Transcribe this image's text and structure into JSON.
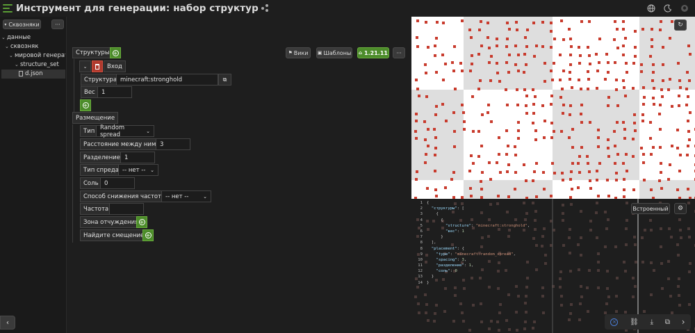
{
  "header": {
    "title": "Инструмент для генерации: набор структур",
    "icons": [
      "globe-icon",
      "moon-icon",
      "github-icon"
    ]
  },
  "sidebar": {
    "project_button": "Сквозняки",
    "more_label": "···",
    "tree": [
      {
        "label": "данные",
        "level": 0,
        "expanded": true
      },
      {
        "label": "сквозняк",
        "level": 1,
        "expanded": true
      },
      {
        "label": "мировой генератор",
        "level": 2,
        "expanded": true
      },
      {
        "label": "structure_set",
        "level": 3,
        "expanded": true
      },
      {
        "label": "d.json",
        "level": 4,
        "file": true,
        "selected": true
      }
    ]
  },
  "toolbar": {
    "wiki_label": "Вики",
    "templates_label": "Шаблоны",
    "version_label": "1.21.11",
    "more_label": "···"
  },
  "editor": {
    "structures_label": "Структуры",
    "entry_label": "Вход",
    "structure_field_label": "Структура",
    "structure_value": "minecraft:stronghold",
    "weight_label": "Вес",
    "weight_value": "1",
    "placement_label": "Размещение",
    "type_label": "Тип",
    "type_value": "Random spread",
    "spacing_label": "Расстояние между ними",
    "spacing_value": "3",
    "separation_label": "Разделение",
    "separation_value": "1",
    "spread_type_label": "Тип спреда",
    "spread_type_value": "-- нет --",
    "salt_label": "Соль",
    "salt_value": "0",
    "freq_method_label": "Способ снижения частоты",
    "freq_method_value": "-- нет --",
    "frequency_label": "Частота",
    "frequency_value": "",
    "exclusion_label": "Зона отчуждения",
    "offset_label": "Найдите смещение"
  },
  "preview": {
    "colors": {
      "light": "#ffffff",
      "gray": "#dedede",
      "marker": "#c83a2c"
    }
  },
  "code_panel": {
    "format_button": "Встроенный",
    "lines": [
      {
        "n": "1",
        "text": "{"
      },
      {
        "n": "2",
        "text": "  \"структуры\": ["
      },
      {
        "n": "3",
        "text": "    {"
      },
      {
        "n": "4",
        "text": "      {"
      },
      {
        "n": "5",
        "text": "        \"structure\": \"minecraft:stronghold\","
      },
      {
        "n": "6",
        "text": "        \"вес\": 1"
      },
      {
        "n": "7",
        "text": "      }"
      },
      {
        "n": "8",
        "text": "  ],"
      },
      {
        "n": "8",
        "text": "  \"placement\": {"
      },
      {
        "n": "9",
        "text": "    \"type\": \"minecraft:random_spread\","
      },
      {
        "n": "10",
        "text": "    \"spacing\": 3,"
      },
      {
        "n": "11",
        "text": "    \"разделение\": 1,"
      },
      {
        "n": "12",
        "text": "    \"соль\": 0"
      },
      {
        "n": "13",
        "text": "  }"
      },
      {
        "n": "14",
        "text": "}"
      }
    ]
  }
}
